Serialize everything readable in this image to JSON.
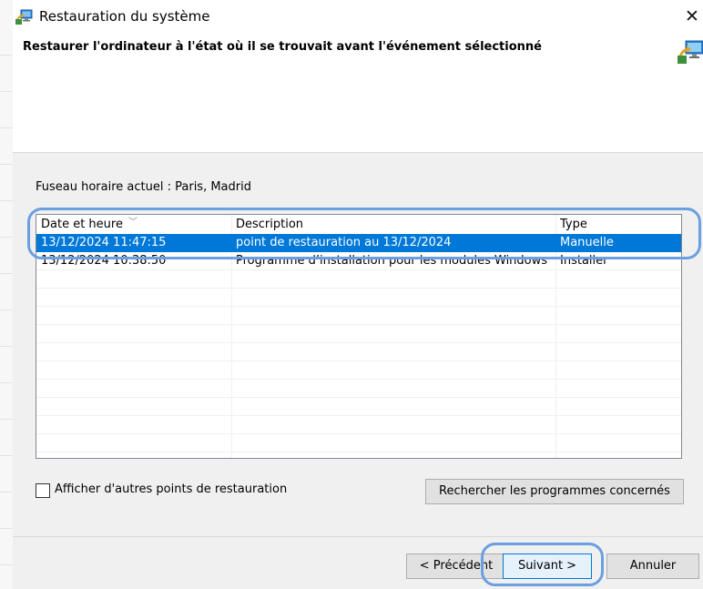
{
  "window": {
    "title": "Restauration du système",
    "close_glyph": "✕"
  },
  "header": {
    "title": "Restaurer l'ordinateur à l'état où il se trouvait avant l'événement sélectionné"
  },
  "content": {
    "timezone_label": "Fuseau horaire actuel : Paris, Madrid",
    "list": {
      "columns": [
        "Date et heure",
        "Description",
        "Type"
      ],
      "sorted_column_indicator": "﹀",
      "rows": [
        {
          "date": "13/12/2024 11:47:15",
          "description": "point de restauration au 13/12/2024",
          "type": "Manuelle",
          "selected": true
        },
        {
          "date": "13/12/2024 10:38:50",
          "description": "Programme d’installation pour les modules Windows",
          "type": "Installer",
          "selected": false
        }
      ]
    },
    "show_more_checkbox": {
      "label": "Afficher d'autres points de restauration",
      "checked": false
    },
    "scan_button": "Rechercher les programmes concernés"
  },
  "footer": {
    "prev_button": "< Précédent",
    "next_button": "Suivant >",
    "cancel_button": "Annuler"
  },
  "icons": {
    "title": "system-restore-icon",
    "header": "system-restore-icon"
  },
  "colors": {
    "selection": "#0078d7",
    "annotation_oval": "#6a9fe0",
    "dialog_background": "#f0f0f0"
  }
}
